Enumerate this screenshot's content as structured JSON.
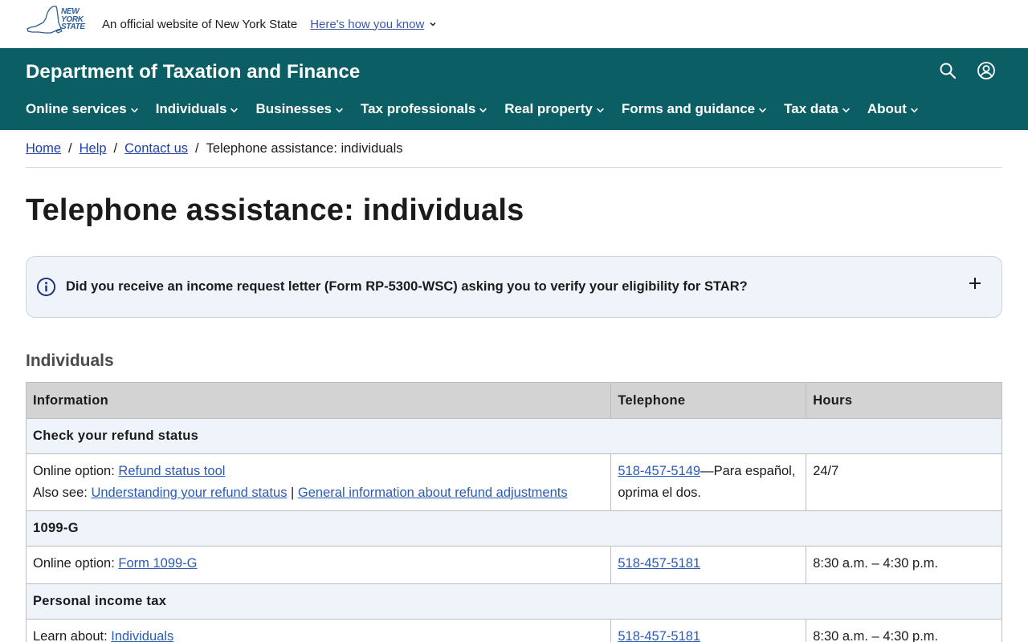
{
  "banner": {
    "logo_text": [
      "NEW",
      "YORK",
      "STATE"
    ],
    "official_text": "An official website of New York State",
    "how_know_label": "Here's how you know"
  },
  "header": {
    "title": "Department of Taxation and Finance",
    "nav": [
      {
        "label": "Online services"
      },
      {
        "label": "Individuals"
      },
      {
        "label": "Businesses"
      },
      {
        "label": "Tax professionals"
      },
      {
        "label": "Real property"
      },
      {
        "label": "Forms and guidance"
      },
      {
        "label": "Tax data"
      },
      {
        "label": "About"
      }
    ],
    "icons": [
      "search-icon",
      "account-icon"
    ]
  },
  "breadcrumb": {
    "items": [
      "Home",
      "Help",
      "Contact us"
    ],
    "separator": "/",
    "current": "Telephone assistance: individuals"
  },
  "page": {
    "title": "Telephone assistance: individuals"
  },
  "alert": {
    "text": "Did you receive an income request letter (Form RP-5300-WSC) asking you to verify your eligibility for STAR?",
    "icon": "info-icon",
    "toggle_icon": "plus-icon"
  },
  "section": {
    "heading": "Individuals"
  },
  "table": {
    "headers": [
      "Information",
      "Telephone",
      "Hours"
    ],
    "groups": [
      {
        "title": "Check your refund status",
        "row": {
          "line1_prefix": "Online option: ",
          "line1_link": "Refund status tool",
          "line2_prefix": "Also see: ",
          "line2_link1": "Understanding your refund status",
          "line2_sep": " | ",
          "line2_link2": "General information about refund adjustments",
          "phone": "518-457-5149",
          "phone_suffix": "—Para español, oprima el dos.",
          "hours": "24/7"
        }
      },
      {
        "title": "1099-G",
        "row": {
          "line1_prefix": "Online option: ",
          "line1_link": "Form 1099-G",
          "phone": "518-457-5181",
          "hours": "8:30 a.m. – 4:30 p.m."
        }
      },
      {
        "title": "Personal income tax",
        "row": {
          "line1_prefix": "Learn about: ",
          "line1_link": "Individuals",
          "phone": "518-457-5181",
          "hours": "8:30 a.m. – 4:30 p.m."
        }
      }
    ]
  },
  "colors": {
    "header_bg": "#0c5e65",
    "link": "#2a5bb5",
    "alert_bg": "#eef4fa",
    "table_header_bg": "#d3d3d3"
  }
}
